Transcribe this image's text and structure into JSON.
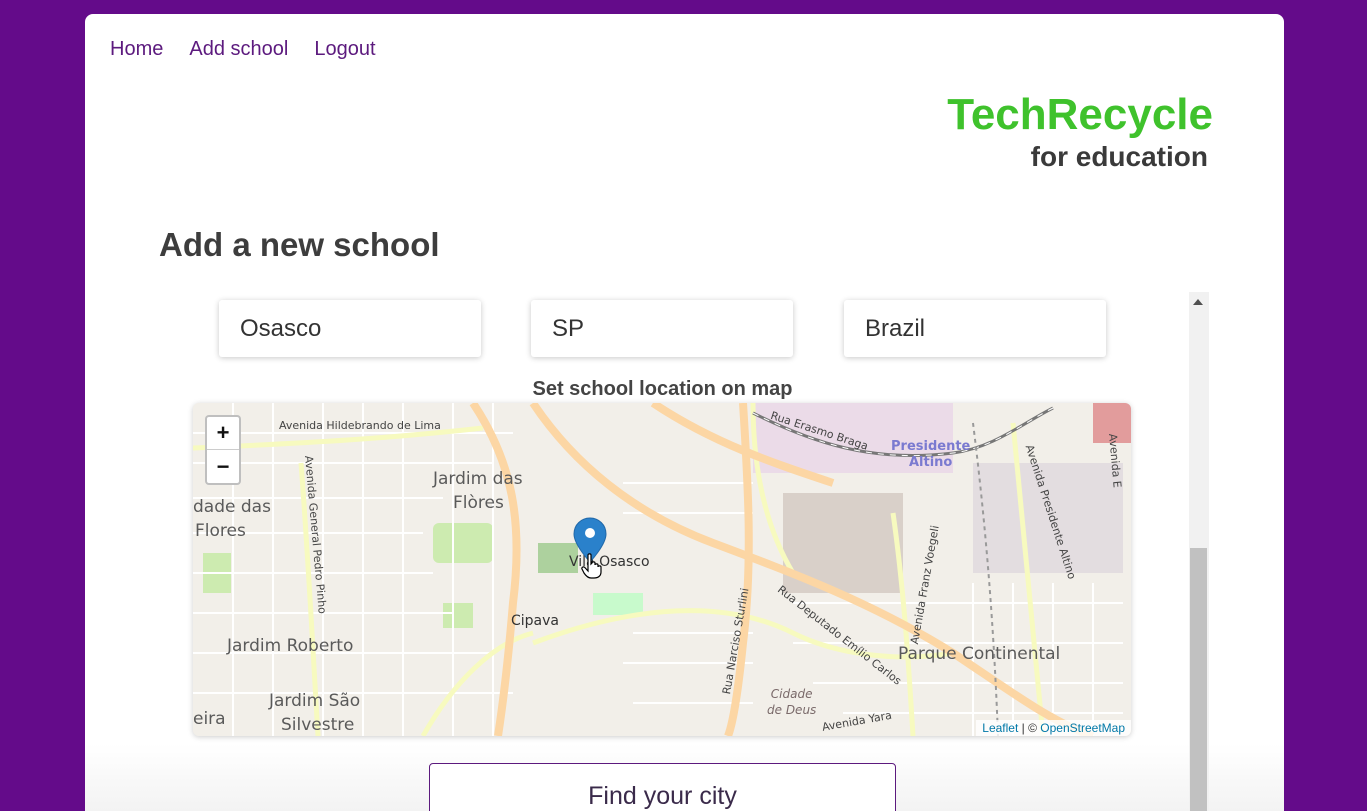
{
  "nav": {
    "home": "Home",
    "add_school": "Add school",
    "logout": "Logout"
  },
  "brand": {
    "name": "TechRecycle",
    "tagline": "for education",
    "name_color": "#3fc22c"
  },
  "page": {
    "title": "Add a new school"
  },
  "form": {
    "city": "Osasco",
    "state": "SP",
    "country": "Brazil",
    "map_label": "Set school location on map",
    "find_button": "Find your city"
  },
  "map": {
    "zoom_in": "+",
    "zoom_out": "−",
    "attribution_leaflet": "Leaflet",
    "attribution_sep": " | © ",
    "attribution_osm": "OpenStreetMap",
    "labels": {
      "av_hildebrando": "Avenida Hildebrando de Lima",
      "jardim_flores_1": "Jardim das",
      "jardim_flores_2": "Flòres",
      "cidade_flores_1": "dade das",
      "cidade_flores_2": "Flores",
      "av_pedro_pinho": "Avenida General Pedro Pinho",
      "vila_osasco": "Vila Osasco",
      "cipava": "Cipava",
      "jardim_roberto": "Jardim Roberto",
      "jardim_sao_1": "Jardim São",
      "jardim_sao_2": "Silvestre",
      "eira": "eira",
      "rua_erasmo": "Rua Erasmo Braga",
      "presidente_1": "Presidente",
      "presidente_2": "Altino",
      "av_pres_altino": "Avenida Presidente Altino",
      "av_franz": "Avenida Franz Voegeli",
      "rua_narciso": "Rua Narciso Sturlini",
      "rua_deputado": "Rua Deputado Emílio Carlos",
      "parque_continental": "Parque Continental",
      "cidade_deus_1": "Cidade",
      "cidade_deus_2": "de Deus",
      "av_yara": "Avenida Yara",
      "av_e": "Avenida E"
    }
  },
  "colors": {
    "background": "#640b8a",
    "nav_link": "#5c1a7e",
    "marker": "#2a81cb"
  }
}
